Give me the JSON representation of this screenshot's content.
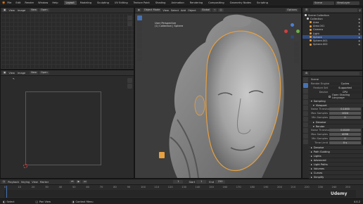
{
  "topbar": {
    "menus": [
      "File",
      "Edit",
      "Render",
      "Window",
      "Help"
    ],
    "workspaces": [
      "Layout",
      "Modeling",
      "Sculpting",
      "UV Editing",
      "Texture Paint",
      "Shading",
      "Animation",
      "Rendering",
      "Compositing",
      "Geometry Nodes",
      "Scripting"
    ],
    "active_workspace": "Layout",
    "scene_label": "Scene",
    "view_layer_label": "ViewLayer"
  },
  "image_editor": {
    "menus": [
      "View",
      "Image"
    ],
    "new_label": "New",
    "open_label": "Open"
  },
  "viewport": {
    "mode_label": "Object Mode",
    "menus": [
      "View",
      "Select",
      "Add",
      "Object"
    ],
    "transform_label": "Global",
    "options_label": "Options",
    "info_line1": "User Perspective",
    "info_line2": "(1) Collection | Sphere"
  },
  "outliner": {
    "title": "Scene Collection",
    "rows": [
      {
        "label": "Collection",
        "color": "#cfcfcf",
        "selected": false
      },
      {
        "label": "Area",
        "color": "#e8a040",
        "selected": false
      },
      {
        "label": "Area.001",
        "color": "#e8a040",
        "selected": false
      },
      {
        "label": "Camera",
        "color": "#e8a040",
        "selected": false
      },
      {
        "label": "Light",
        "color": "#e8a040",
        "selected": false
      },
      {
        "label": "Sphere",
        "color": "#e8a040",
        "selected": true
      },
      {
        "label": "Sphere.001",
        "color": "#e8a040",
        "selected": false
      },
      {
        "label": "Sphere.002",
        "color": "#e8a040",
        "selected": false
      }
    ]
  },
  "properties": {
    "object_name": "Scene",
    "render_engine_label": "Render Engine",
    "render_engine": "Cycles",
    "feature_set_label": "Feature Set",
    "feature_set": "Supported",
    "device_label": "Device",
    "device": "CPU",
    "osl_label": "Open Shading Language",
    "sampling_label": "Sampling",
    "viewport_label": "Viewport",
    "noise_threshold_label": "Noise Threshold",
    "vp_noise_threshold": "0.1000",
    "max_samples_label": "Max Samples",
    "vp_max_samples": "1024",
    "min_samples_label": "Min Samples",
    "vp_min_samples": "0",
    "denoise_label": "Denoise",
    "render_label": "Render",
    "r_noise_threshold": "0.0100",
    "r_max_samples": "4096",
    "r_min_samples": "0",
    "time_limit_label": "Time Limit",
    "time_limit": "0 s",
    "sections": [
      "Denoise",
      "Path Guiding",
      "Lights",
      "Advanced",
      "Light Paths",
      "Volumes",
      "Curves",
      "Simplify"
    ]
  },
  "timeline": {
    "menus": [
      "Playback",
      "Keying",
      "View",
      "Marker"
    ],
    "start_label": "Start",
    "start": "1",
    "end_label": "End",
    "end": "250",
    "current_frame": "1",
    "ticks": [
      "0",
      "10",
      "20",
      "30",
      "40",
      "50",
      "60",
      "70",
      "80",
      "90",
      "100",
      "110",
      "120",
      "130",
      "140",
      "150",
      "160",
      "170",
      "180",
      "190",
      "200",
      "210",
      "220",
      "230",
      "240",
      "250"
    ]
  },
  "statusbar": {
    "select_label": "Select",
    "pan_label": "Pan View",
    "context_label": "Context Menu",
    "version": "4.0.2"
  },
  "watermark": "Udemy"
}
